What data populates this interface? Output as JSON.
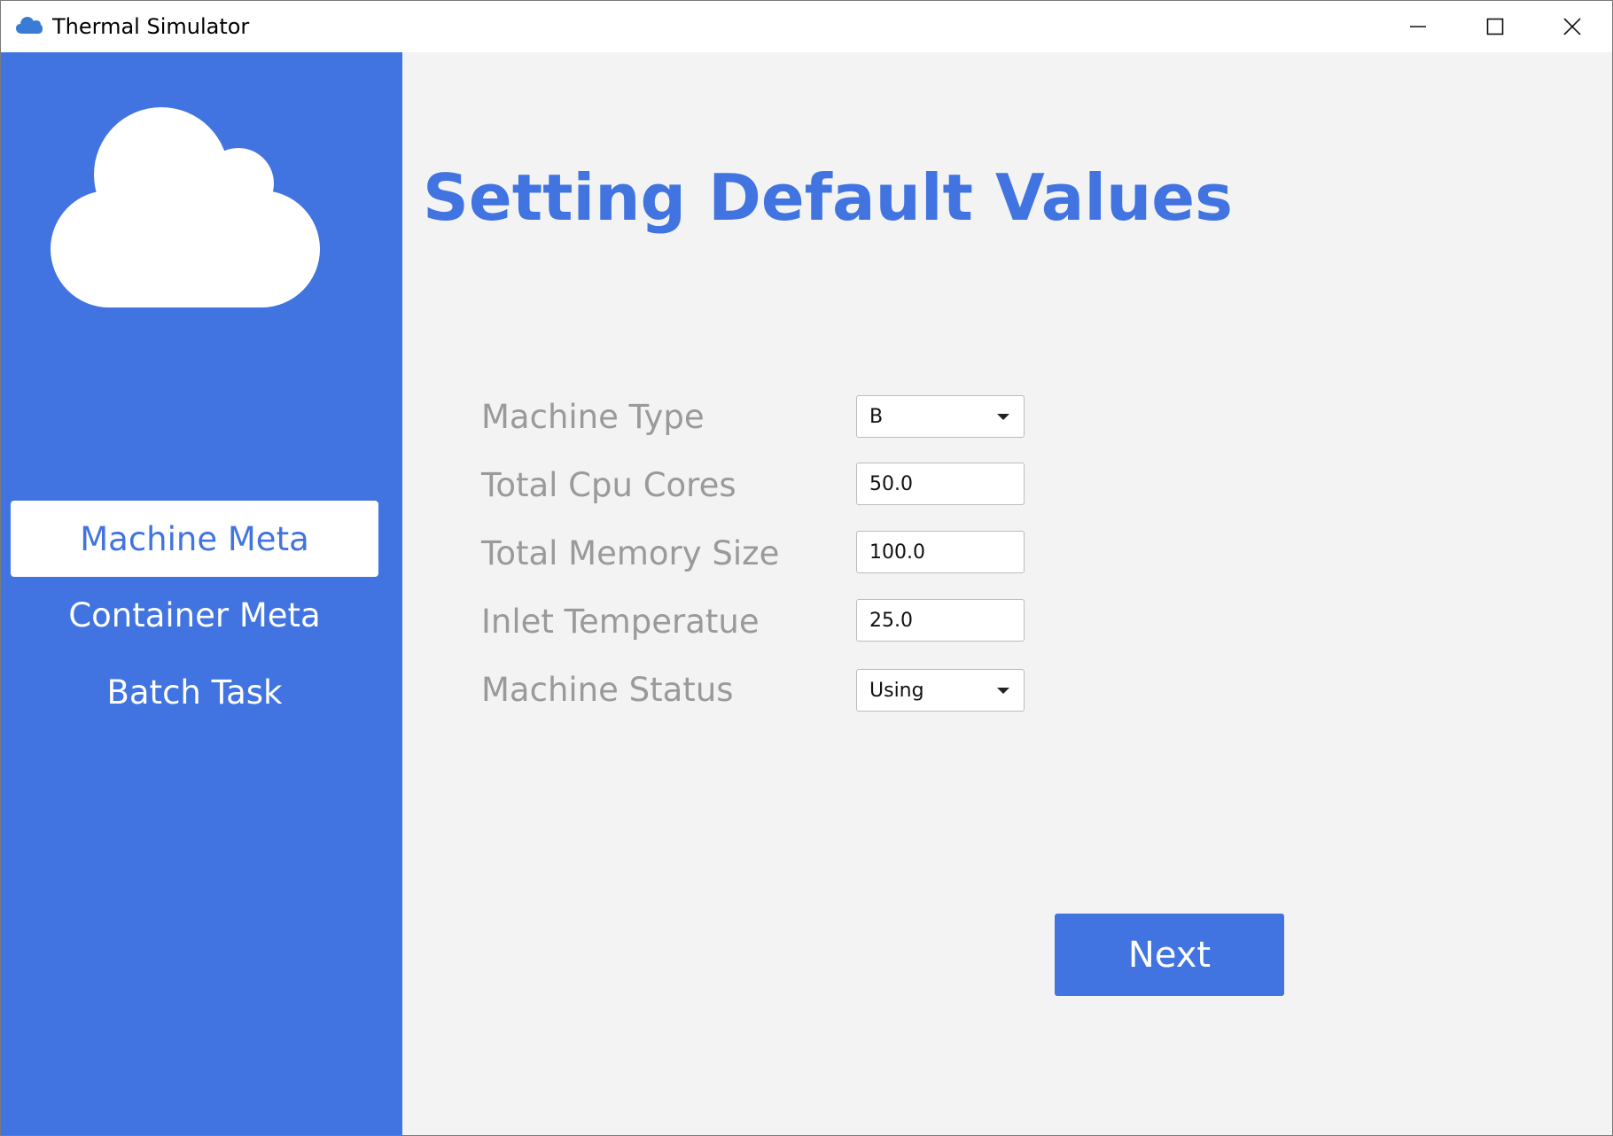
{
  "window": {
    "title": "Thermal Simulator",
    "title_icon": "cloud-icon",
    "controls": [
      "minimize-icon",
      "maximize-icon",
      "close-icon"
    ]
  },
  "sidebar": {
    "logo_icon": "cloud-icon",
    "items": [
      {
        "label": "Machine Meta",
        "active": true
      },
      {
        "label": "Container Meta",
        "active": false
      },
      {
        "label": "Batch Task",
        "active": false
      }
    ]
  },
  "main": {
    "title": "Setting Default Values",
    "fields": [
      {
        "label": "Machine Type",
        "type": "select",
        "value": "B"
      },
      {
        "label": "Total Cpu Cores",
        "type": "text",
        "value": "50.0"
      },
      {
        "label": "Total Memory Size",
        "type": "text",
        "value": "100.0"
      },
      {
        "label": "Inlet Temperatue",
        "type": "text",
        "value": "25.0"
      },
      {
        "label": "Machine Status",
        "type": "select",
        "value": "Using"
      }
    ],
    "next_label": "Next"
  },
  "colors": {
    "accent": "#4174e0",
    "content_background": "#f3f3f3",
    "label_text": "#9a9a9a"
  }
}
